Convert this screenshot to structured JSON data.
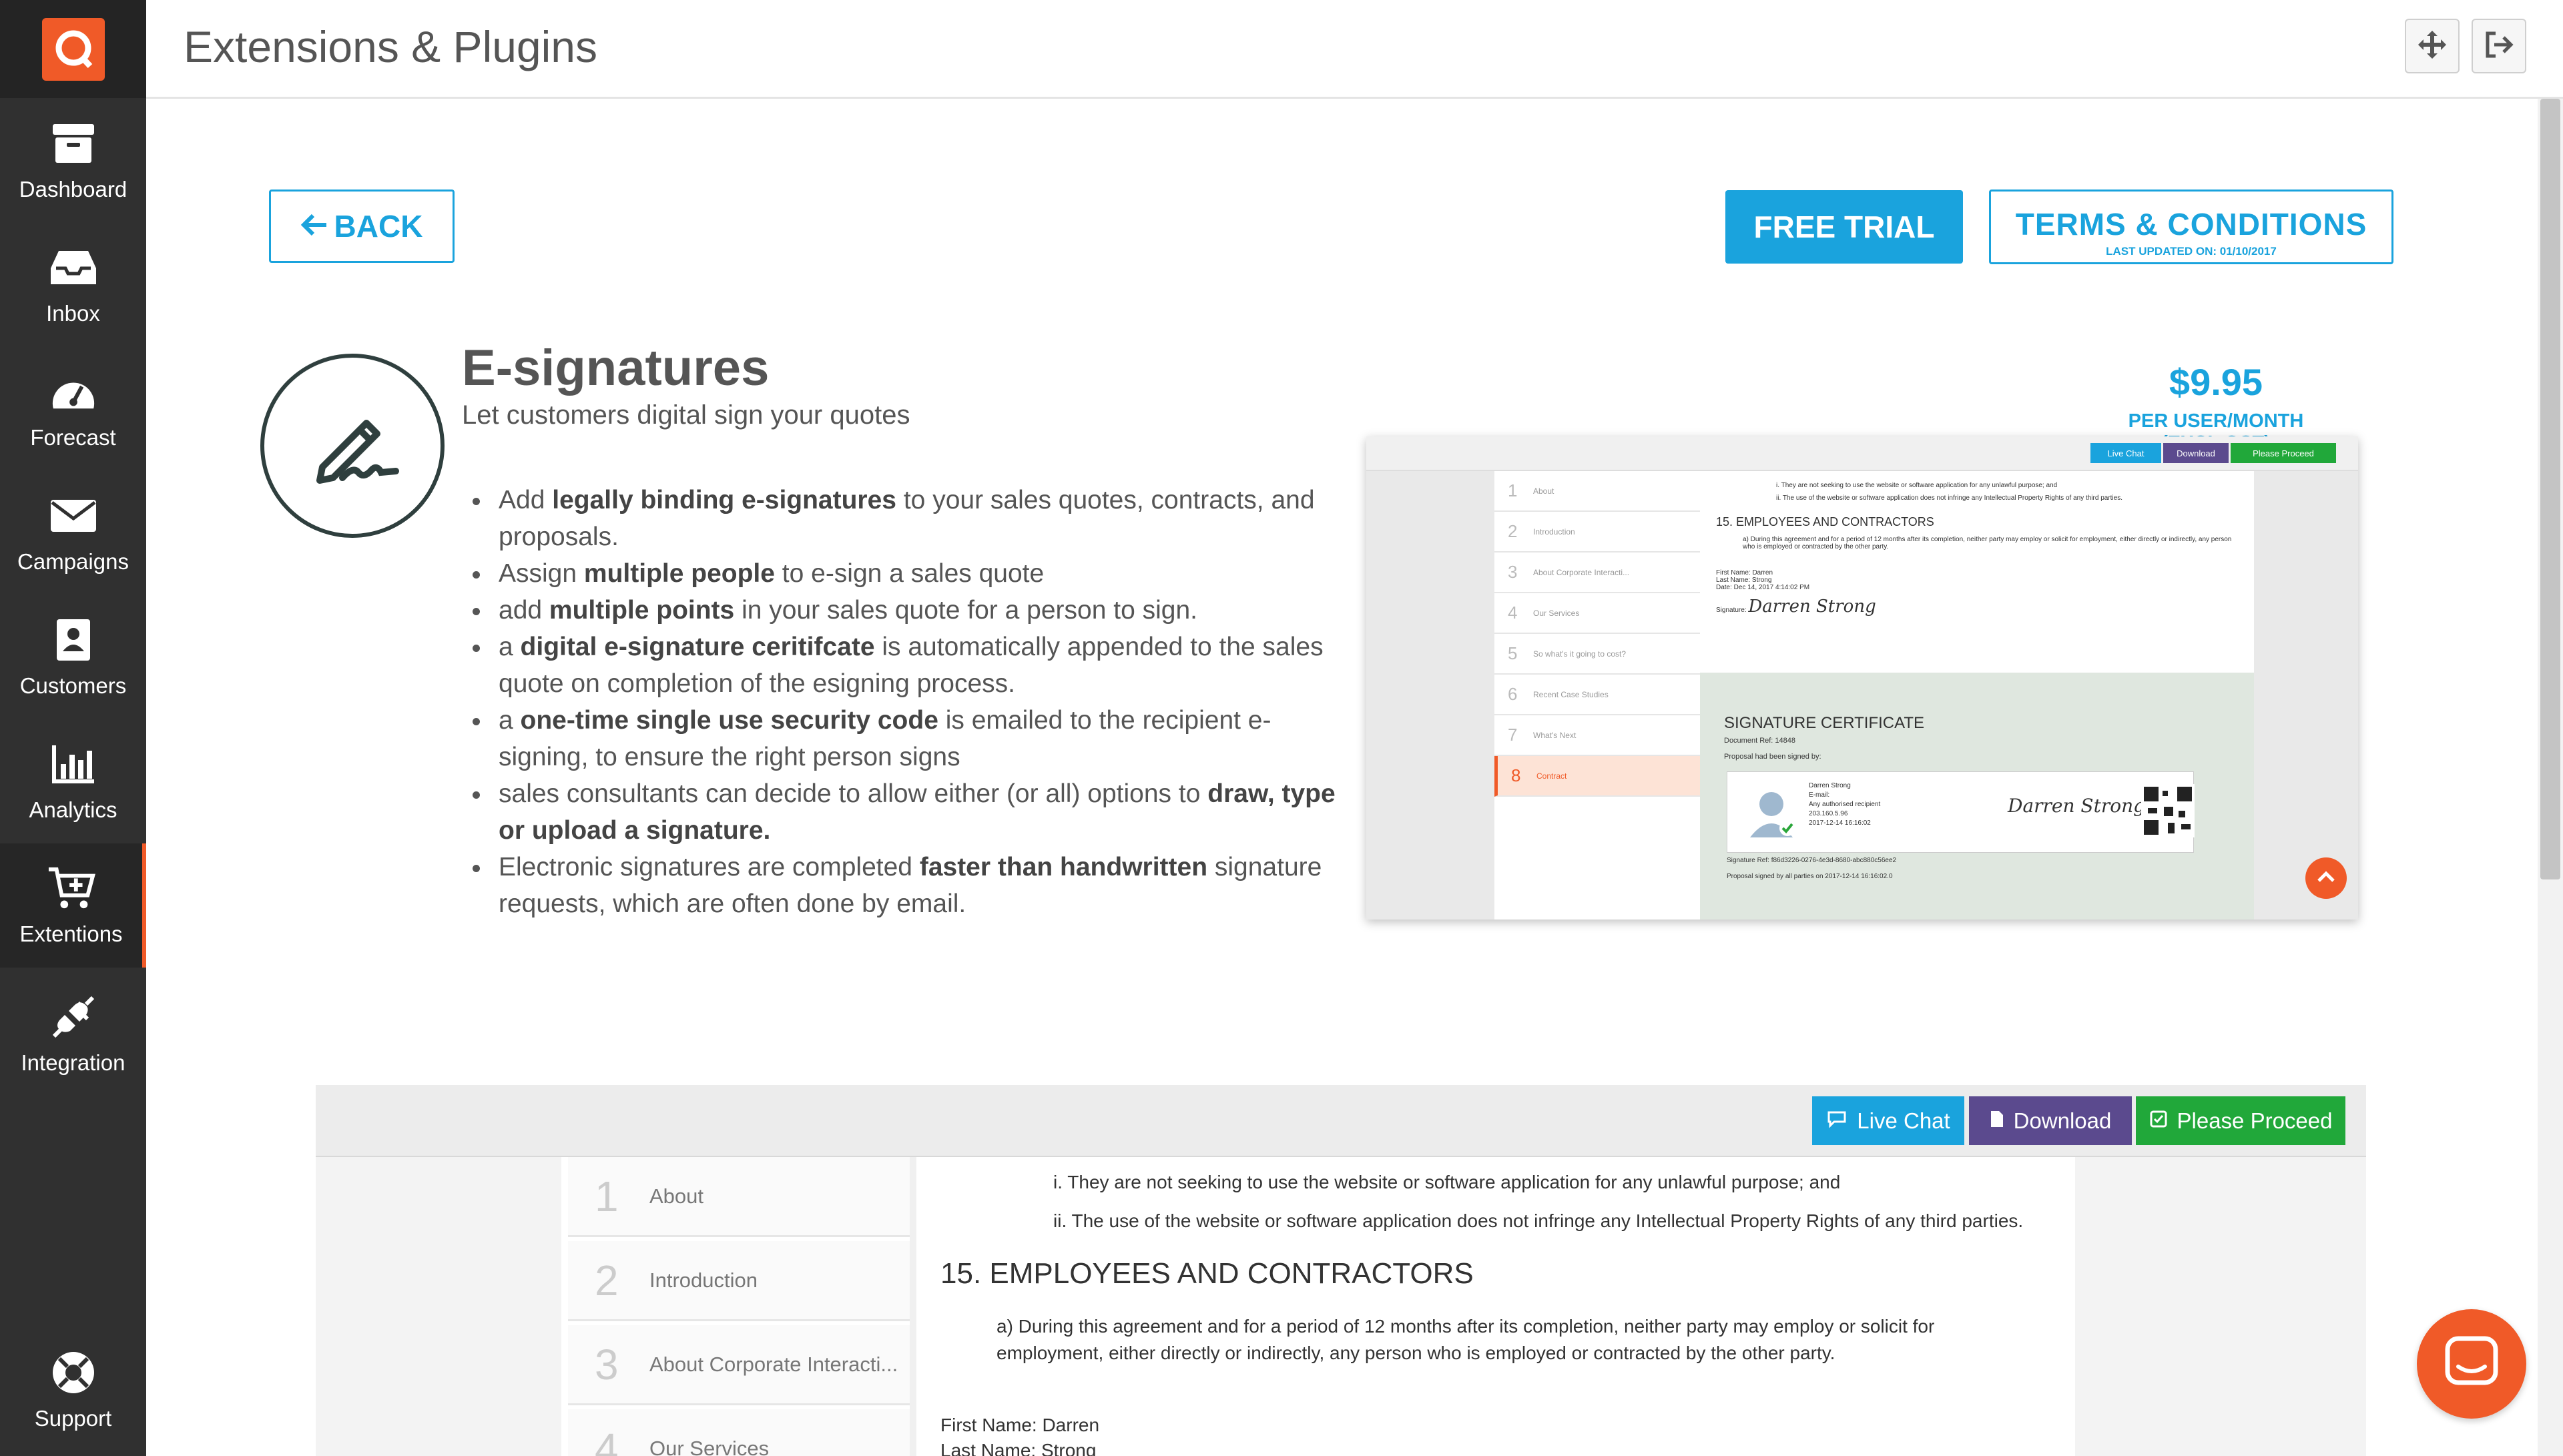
{
  "header": {
    "title": "Extensions & Plugins"
  },
  "nav": [
    {
      "label": "Dashboard",
      "icon": "archive-icon"
    },
    {
      "label": "Inbox",
      "icon": "inbox-icon"
    },
    {
      "label": "Forecast",
      "icon": "gauge-icon"
    },
    {
      "label": "Campaigns",
      "icon": "envelope-icon"
    },
    {
      "label": "Customers",
      "icon": "contact-card-icon"
    },
    {
      "label": "Analytics",
      "icon": "bar-chart-icon"
    },
    {
      "label": "Extentions",
      "icon": "cart-plus-icon",
      "active": true
    },
    {
      "label": "Integration",
      "icon": "plug-icon"
    },
    {
      "label": "Support",
      "icon": "lifebuoy-icon"
    }
  ],
  "actions": {
    "back": "BACK",
    "free_trial": "FREE TRIAL",
    "terms": "TERMS & CONDITIONS",
    "terms_updated": "LAST UPDATED ON: 01/10/2017"
  },
  "product": {
    "title": "E-signatures",
    "subtitle": "Let customers digital sign your quotes",
    "price": "$9.95",
    "price_unit": "PER USER/MONTH (EXCL GST)",
    "features": [
      {
        "parts": [
          "Add ",
          "legally binding e-signatures",
          " to your sales quotes, contracts, and proposals."
        ]
      },
      {
        "parts": [
          "Assign ",
          "multiple people",
          " to e-sign a sales quote"
        ]
      },
      {
        "parts": [
          "add ",
          "multiple points",
          " in your sales quote for a person to sign."
        ]
      },
      {
        "parts": [
          "a ",
          "digital e-signature ceritifcate",
          " is automatically appended to the sales quote on completion of the esigning process."
        ]
      },
      {
        "parts": [
          "a ",
          "one-time single use security code",
          " is emailed to the recipient e-signing, to ensure the right person signs"
        ]
      },
      {
        "parts": [
          "sales consultants can decide to allow either (or all) options to ",
          "draw, type or upload a signature.",
          ""
        ]
      },
      {
        "parts": [
          "Electronic signatures are completed ",
          "faster than handwritten",
          " signature requests, which are often done by email."
        ]
      }
    ]
  },
  "preview": {
    "buttons": {
      "live_chat": "Live Chat",
      "download": "Download",
      "proceed": "Please Proceed"
    },
    "sections": [
      {
        "num": "1",
        "label": "About"
      },
      {
        "num": "2",
        "label": "Introduction"
      },
      {
        "num": "3",
        "label": "About Corporate Interacti..."
      },
      {
        "num": "4",
        "label": "Our Services"
      },
      {
        "num": "5",
        "label": "So what's it going to cost?"
      },
      {
        "num": "6",
        "label": "Recent Case Studies"
      },
      {
        "num": "7",
        "label": "What's Next"
      },
      {
        "num": "8",
        "label": "Contract"
      }
    ],
    "doc": {
      "clause_i": "i. They are not seeking to use the website or software application for any unlawful purpose; and",
      "clause_ii": "ii. The use of the website or software application does not infringe any Intellectual Property Rights of any third parties.",
      "heading": "15. EMPLOYEES AND CONTRACTORS",
      "clause_a": "a) During this agreement and for a period of 12 months after its completion, neither party may employ or solicit for employment, either directly or indirectly, any person who is employed or contracted by the other party.",
      "first_name": "First Name: Darren",
      "last_name": "Last Name: Strong",
      "date": "Date: Dec 14, 2017 4:14:02 PM",
      "signature_label": "Signature:",
      "signature": "Darren Strong"
    },
    "certificate": {
      "title": "SIGNATURE CERTIFICATE",
      "doc_ref": "Document Ref: 14848",
      "signed_by": "Proposal had been signed by:",
      "signer_name": "Darren Strong",
      "signer_email": "E-mail:",
      "signer_role": "Any authorised recipient",
      "signer_ip": "203.160.5.96",
      "signer_date": "2017-12-14 16:16:02",
      "signature": "Darren Strong",
      "sig_ref": "Signature Ref: f86d3226-0276-4e3d-8680-abc880c56ee2",
      "footer": "Proposal signed by all parties on 2017-12-14 16:16:02.0"
    }
  }
}
